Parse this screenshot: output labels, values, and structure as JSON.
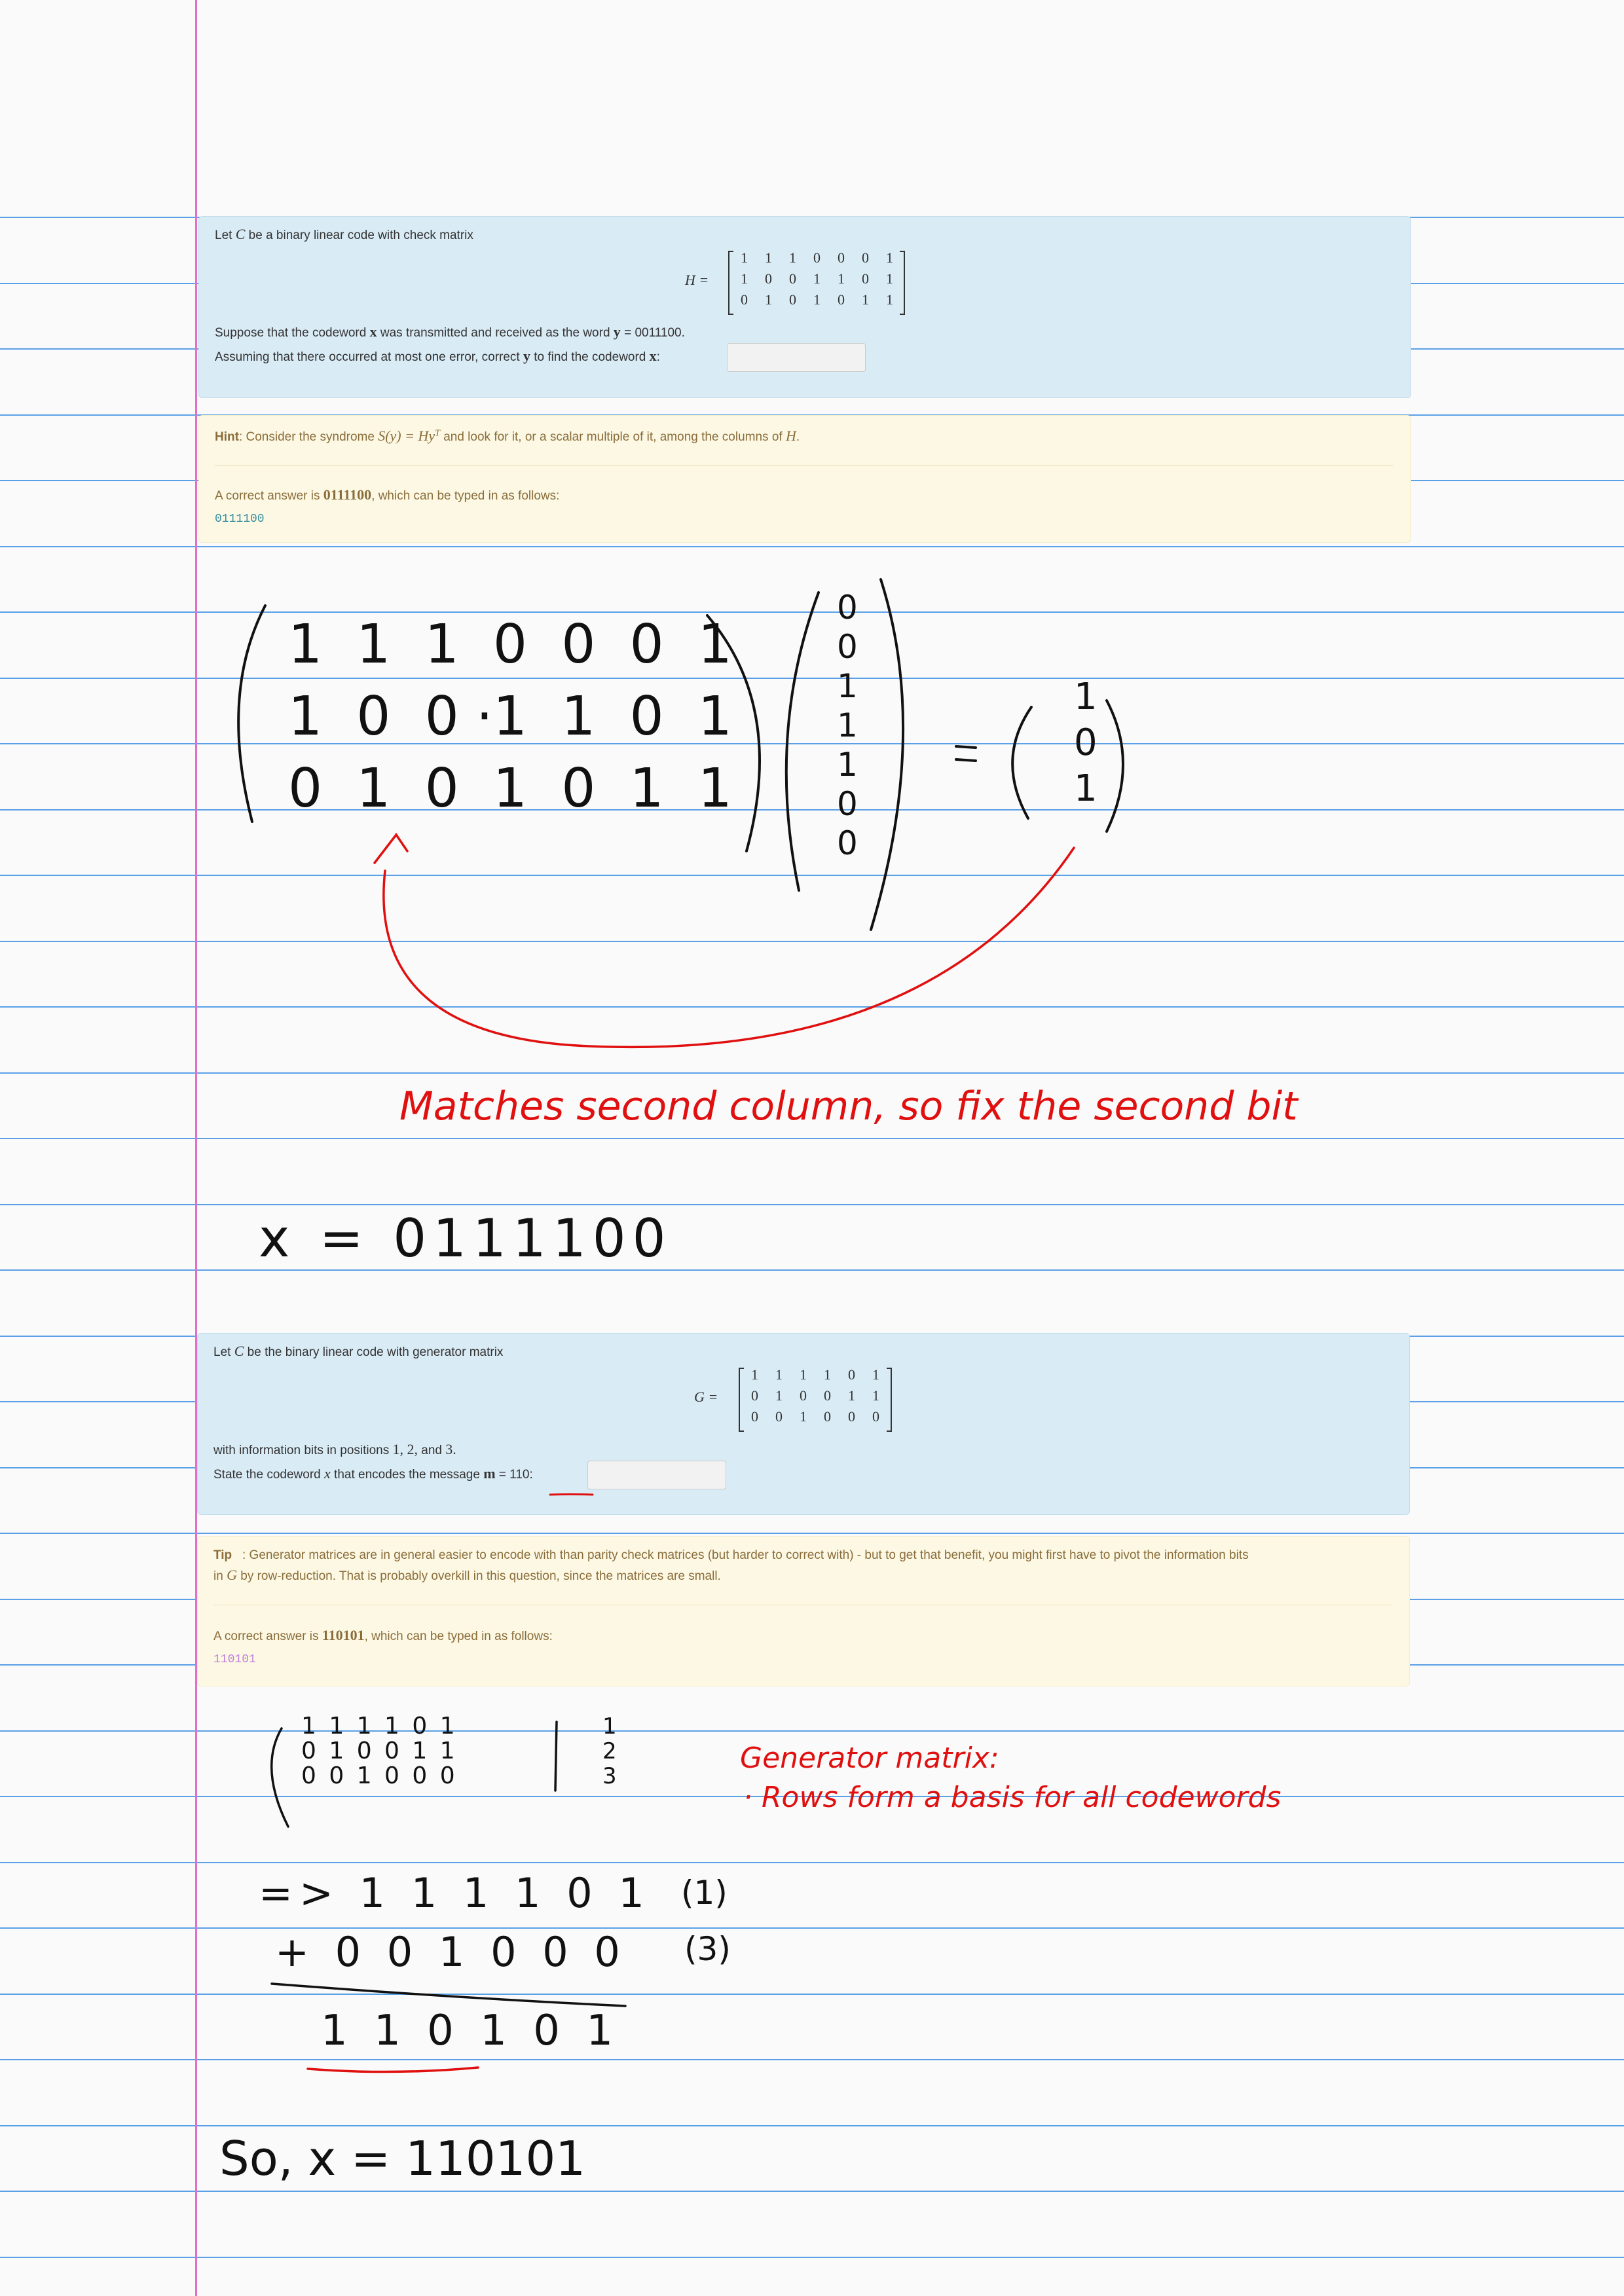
{
  "q1": {
    "intro_pre": "Let ",
    "intro_C": "C",
    "intro_post": " be a binary linear code with check matrix",
    "matrix_label": "H =",
    "matrix_rows": [
      [
        "1",
        "1",
        "1",
        "0",
        "0",
        "0",
        "1"
      ],
      [
        "1",
        "0",
        "0",
        "1",
        "1",
        "0",
        "1"
      ],
      [
        "0",
        "1",
        "0",
        "1",
        "0",
        "1",
        "1"
      ]
    ],
    "line2_pre": "Suppose that the codeword ",
    "line2_x": "x",
    "line2_mid": " was transmitted and received as the word ",
    "line2_y": "y",
    "line2_post": " = 0011100.",
    "line3_pre": "Assuming that there occurred at most one error, correct ",
    "line3_y": "y",
    "line3_mid": " to find the codeword ",
    "line3_x": "x",
    "line3_post": ":",
    "answer_value": ""
  },
  "hint1": {
    "label": "Hint",
    "text_pre": ": Consider the syndrome ",
    "syndrome": "S(y) = Hy",
    "sup": "T",
    "text_post": " and look for it, or a scalar multiple of it, among the columns of ",
    "H": "H",
    "dot": ".",
    "answer_pre": "A correct answer is ",
    "answer_value": "0111100",
    "answer_post": ", which can be typed in as follows:",
    "typed": "0111100"
  },
  "q2": {
    "intro_pre": "Let ",
    "intro_C": "C",
    "intro_post": " be the binary linear code with generator matrix",
    "matrix_label": "G =",
    "matrix_rows": [
      [
        "1",
        "1",
        "1",
        "1",
        "0",
        "1"
      ],
      [
        "0",
        "1",
        "0",
        "0",
        "1",
        "1"
      ],
      [
        "0",
        "0",
        "1",
        "0",
        "0",
        "0"
      ]
    ],
    "line2_pre": "with information bits in positions ",
    "line2_vals": "1, 2,",
    "line2_and": " and ",
    "line2_last": "3.",
    "line3_pre": "State the codeword ",
    "line3_x": "x",
    "line3_mid": " that encodes the message ",
    "line3_m": "m",
    "line3_post": " = 110:",
    "answer_value": ""
  },
  "tip2": {
    "label": "Tip",
    "text1": ": Generator matrices are in general easier to encode with than parity check matrices (but harder to correct with) - but to get that benefit, you might first have to pivot the information bits",
    "text2_pre": "in ",
    "text2_G": "G",
    "text2_post": " by row-reduction. That is probably overkill in this question, since the matrices are small.",
    "answer_pre": "A correct answer is ",
    "answer_value": "110101",
    "answer_post": ", which can be typed in as follows:",
    "typed": "110101"
  },
  "handwriting": {
    "matches_note": "Matches second column, so fix the second bit",
    "x_result": "x = 0111100",
    "gen_title": "Generator matrix:",
    "gen_bullet": "· Rows form a basis for all codewords",
    "sum_row1": "=> 1 1 1 1 0 1",
    "sum_row1_tag": "(1)",
    "sum_row2": "+ 0 0 1 0 0 0",
    "sum_row2_tag": "(3)",
    "sum_result": "1 1 0 1 0 1",
    "final": "So, x = 110101",
    "syn_mat_rows": [
      "1  1  1  0  0  0  1",
      "1  0  0 ·1  1  0  1",
      "0  1  0  1  0  1  1"
    ],
    "y_vec": [
      "0",
      "0",
      "1",
      "1",
      "1",
      "0",
      "0"
    ],
    "syn_result": [
      "1",
      "0",
      "1"
    ],
    "gen_rows_small": [
      "1 1 1 1 0 1",
      "0 1 0 0 1 1",
      "0 0 1 0 0 0"
    ],
    "gen_tags": [
      "1",
      "2",
      "3"
    ]
  },
  "colors": {
    "question_bg": "#d9ebf5",
    "hint_bg": "#fcf8e3",
    "red_ink": "#e01010",
    "margin": "#e070c8",
    "rule": "#5aa0e6"
  }
}
